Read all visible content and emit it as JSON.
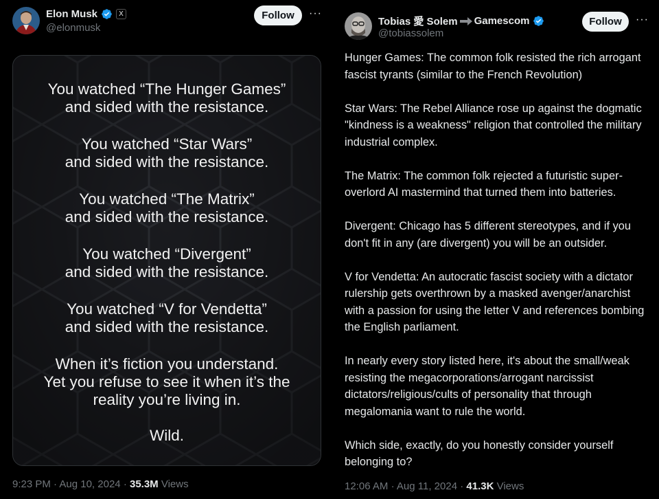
{
  "left_tweet": {
    "author": {
      "name": "Elon Musk",
      "handle": "@elonmusk",
      "x_badge": "X"
    },
    "follow_label": "Follow",
    "more_label": "···",
    "image_text": {
      "blocks": [
        {
          "line1": "You watched “The Hunger Games”",
          "line2": "and sided with the resistance."
        },
        {
          "line1": "You watched “Star Wars”",
          "line2": "and sided with the resistance."
        },
        {
          "line1": "You watched “The Matrix”",
          "line2": "and sided with the resistance."
        },
        {
          "line1": "You watched “Divergent”",
          "line2": "and sided with the resistance."
        },
        {
          "line1": "You watched “V for Vendetta”",
          "line2": "and sided with the resistance."
        }
      ],
      "closing": {
        "line1": "When it’s fiction you understand.",
        "line2": "Yet you refuse to see it when it’s the",
        "line3": "reality you’re living in."
      },
      "final": "Wild."
    },
    "meta": {
      "time": "9:23 PM",
      "date": "Aug 10, 2024",
      "views_count": "35.3M",
      "views_label": "Views"
    }
  },
  "right_tweet": {
    "author": {
      "name": "Tobias 愛 Solem",
      "name_suffix": "Gamescom",
      "handle": "@tobiassolem"
    },
    "follow_label": "Follow",
    "more_label": "···",
    "paragraphs": [
      "Hunger Games: The common folk resisted the rich arrogant fascist tyrants (similar to the French Revolution)",
      "Star Wars: The Rebel Alliance rose up against the dogmatic \"kindness is a weakness\" religion that controlled the military industrial complex.",
      "The Matrix: The common folk rejected a futuristic super-overlord AI mastermind that turned them into batteries.",
      "Divergent: Chicago has 5 different stereotypes, and if you don't fit in any (are divergent) you will be an outsider.",
      "V for Vendetta: An autocratic fascist society with a dictator rulership gets overthrown by a masked avenger/anarchist with a passion for using the letter V and references bombing the English parliament.",
      "In nearly every story listed here, it's about the small/weak resisting the megacorporations/arrogant narcissist dictators/religious/cults of personality that through megalomania want to rule the world.",
      "Which side, exactly, do you honestly consider yourself belonging to?"
    ],
    "meta": {
      "time": "12:06 AM",
      "date": "Aug 11, 2024",
      "views_count": "41.3K",
      "views_label": "Views"
    }
  },
  "colors": {
    "background": "#000000",
    "verified": "#1d9bf0",
    "muted": "#71767b",
    "text": "#e7e9ea"
  }
}
